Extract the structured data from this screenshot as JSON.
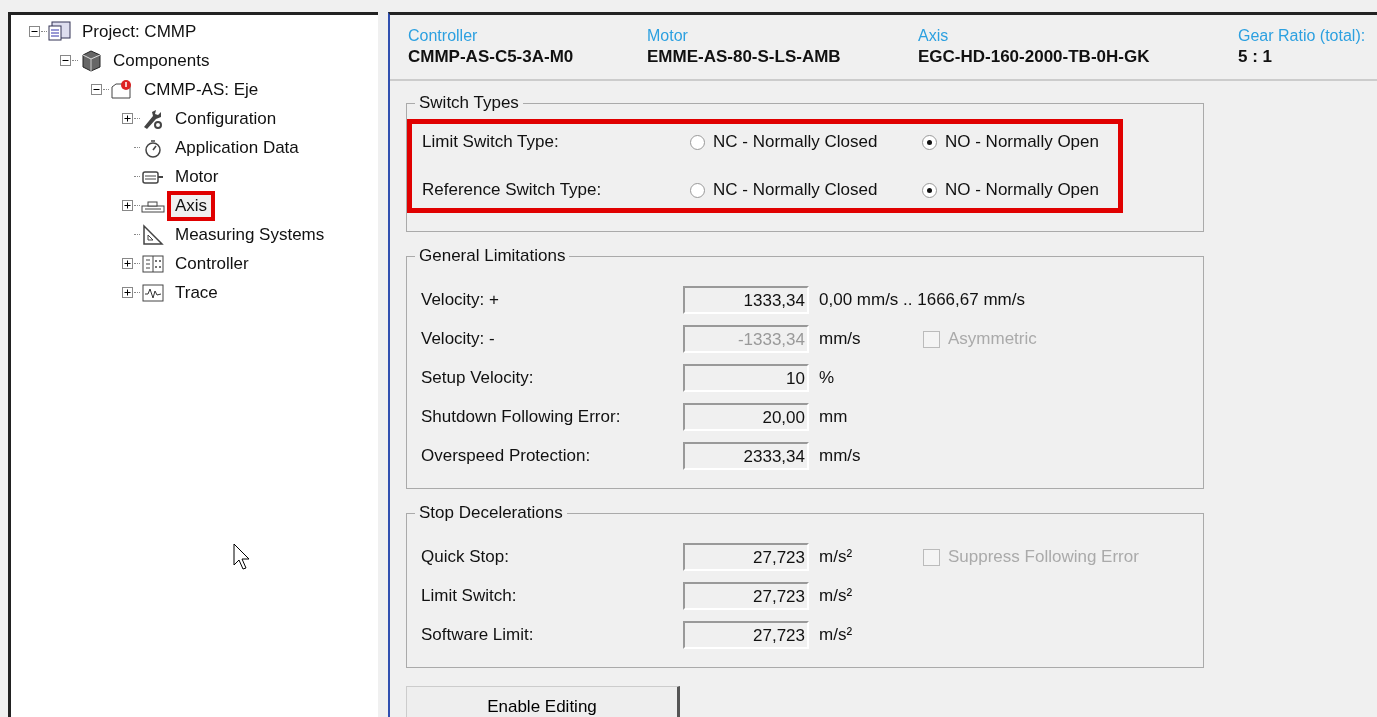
{
  "tree": [
    {
      "label": "Project: CMMP",
      "kind": "project",
      "expanded": true,
      "highlighted": false,
      "children": [
        {
          "label": "Components",
          "kind": "components",
          "expanded": true,
          "highlighted": false,
          "children": [
            {
              "label": "CMMP-AS: Eje",
              "kind": "device",
              "expanded": true,
              "highlighted": false,
              "children": [
                {
                  "label": "Configuration",
                  "kind": "wrench",
                  "expanded": false,
                  "highlighted": false
                },
                {
                  "label": "Application Data",
                  "kind": "gauge",
                  "highlighted": false
                },
                {
                  "label": "Motor",
                  "kind": "motor",
                  "highlighted": false
                },
                {
                  "label": "Axis",
                  "kind": "axis",
                  "expanded": false,
                  "highlighted": true
                },
                {
                  "label": "Measuring Systems",
                  "kind": "ruler",
                  "highlighted": false
                },
                {
                  "label": "Controller",
                  "kind": "controller",
                  "expanded": false,
                  "highlighted": false
                },
                {
                  "label": "Trace",
                  "kind": "trace",
                  "expanded": false,
                  "highlighted": false
                }
              ]
            }
          ]
        }
      ]
    }
  ],
  "header": [
    {
      "label": "Controller",
      "value": "CMMP-AS-C5-3A-M0"
    },
    {
      "label": "Motor",
      "value": "EMME-AS-80-S-LS-AMB"
    },
    {
      "label": "Axis",
      "value": "EGC-HD-160-2000-TB-0H-GK"
    },
    {
      "label": "Gear Ratio (total):",
      "value": "5 : 1"
    }
  ],
  "switch_types": {
    "title": "Switch Types",
    "highlighted": true,
    "rows": [
      {
        "label": "Limit Switch Type:",
        "options": [
          {
            "label": "NC - Normally Closed",
            "selected": false
          },
          {
            "label": "NO - Normally Open",
            "selected": true
          }
        ]
      },
      {
        "label": "Reference Switch Type:",
        "options": [
          {
            "label": "NC - Normally Closed",
            "selected": false
          },
          {
            "label": "NO - Normally Open",
            "selected": true
          }
        ]
      }
    ]
  },
  "groups": [
    {
      "title": "General Limitations",
      "rows": [
        {
          "label": "Velocity: +",
          "value": "1333,34",
          "disabled": false,
          "unit": "0,00 mm/s .. 1666,67 mm/s"
        },
        {
          "label": "Velocity: -",
          "value": "-1333,34",
          "disabled": true,
          "unit": "mm/s",
          "checkbox": {
            "label": "Asymmetric",
            "checked": false,
            "disabled": true
          }
        },
        {
          "label": "Setup Velocity:",
          "value": "10",
          "disabled": false,
          "unit": "%"
        },
        {
          "label": "Shutdown Following Error:",
          "value": "20,00",
          "disabled": false,
          "unit": "mm"
        },
        {
          "label": "Overspeed Protection:",
          "value": "2333,34",
          "disabled": false,
          "unit": "mm/s"
        }
      ]
    },
    {
      "title": "Stop Decelerations",
      "rows": [
        {
          "label": "Quick Stop:",
          "value": "27,723",
          "disabled": false,
          "unit": "m/s²",
          "checkbox": {
            "label": "Suppress Following Error",
            "checked": false,
            "disabled": true
          }
        },
        {
          "label": "Limit Switch:",
          "value": "27,723",
          "disabled": false,
          "unit": "m/s²"
        },
        {
          "label": "Software Limit:",
          "value": "27,723",
          "disabled": false,
          "unit": "m/s²"
        }
      ]
    }
  ],
  "button": "Enable Editing"
}
